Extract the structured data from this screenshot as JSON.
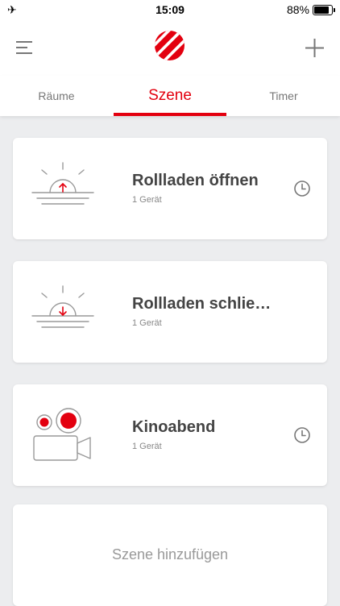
{
  "status_bar": {
    "time": "15:09",
    "battery": "88%",
    "battery_level": 0.88
  },
  "header": {
    "menu_icon": "hamburger-menu-icon",
    "logo_icon": "brand-logo-icon",
    "add_icon": "plus-icon",
    "accent_color": "#E3000F"
  },
  "tabs": [
    {
      "label": "Räume",
      "active": false
    },
    {
      "label": "Szene",
      "active": true
    },
    {
      "label": "Timer",
      "active": false
    }
  ],
  "scenes": [
    {
      "title": "Rollladen öffnen",
      "subtitle": "1 Gerät",
      "icon": "sunrise-icon",
      "timer": true
    },
    {
      "title": "Rollladen schlie…",
      "subtitle": "1 Gerät",
      "icon": "sunset-icon",
      "timer": false
    },
    {
      "title": "Kinoabend",
      "subtitle": "1 Gerät",
      "icon": "movie-camera-icon",
      "timer": true
    }
  ],
  "add_scene": {
    "label": "Szene hinzufügen"
  }
}
